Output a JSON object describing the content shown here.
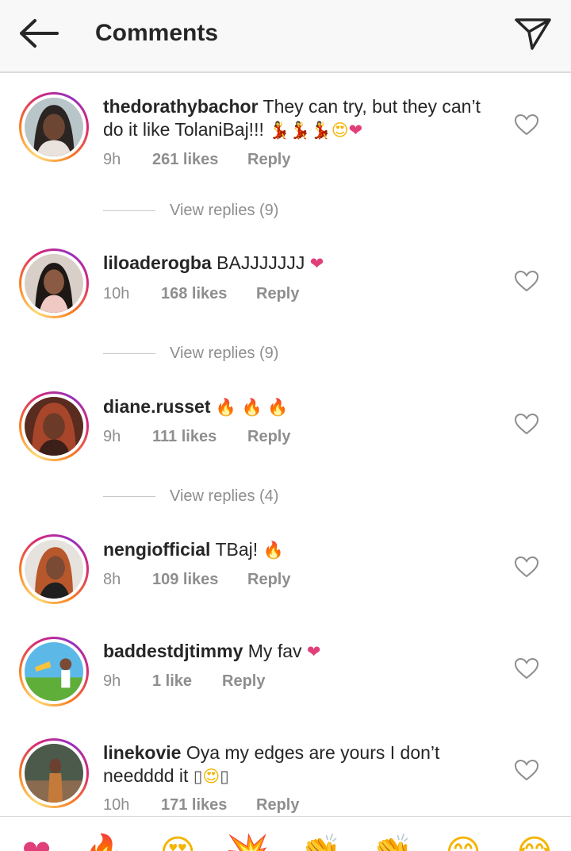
{
  "header": {
    "title": "Comments",
    "back_icon": "arrow-left-icon",
    "send_icon": "paper-plane-icon"
  },
  "comments": [
    {
      "username": "thedorathybachor",
      "text": "They can try, but they can’t do it like TolaniBaj!!!",
      "emojis": [
        "💃",
        "💃",
        "💃",
        "😍",
        "❤"
      ],
      "time": "9h",
      "likes": "261 likes",
      "reply": "Reply",
      "view_replies": "View replies (9)"
    },
    {
      "username": "liloaderogba",
      "text": "BAJJJJJJJ",
      "emojis": [
        "❤"
      ],
      "time": "10h",
      "likes": "168 likes",
      "reply": "Reply",
      "view_replies": "View replies (9)"
    },
    {
      "username": "diane.russet",
      "text": "",
      "emojis": [
        "🔥",
        "🔥",
        "🔥"
      ],
      "time": "9h",
      "likes": "111 likes",
      "reply": "Reply",
      "view_replies": "View replies (4)"
    },
    {
      "username": "nengiofficial",
      "text": "TBaj!",
      "emojis": [
        "🔥"
      ],
      "time": "8h",
      "likes": "109 likes",
      "reply": "Reply"
    },
    {
      "username": "baddestdjtimmy",
      "text": "My fav",
      "emojis": [
        "❤"
      ],
      "time": "9h",
      "likes": "1 like",
      "reply": "Reply"
    },
    {
      "username": "linekovie",
      "text": "Oya my edges are yours I don’t needddd it",
      "emojis": [
        "▯",
        "😍",
        "▯"
      ],
      "time": "10h",
      "likes": "171 likes",
      "reply": "Reply"
    }
  ],
  "emoji_bar": [
    "❤",
    "🔥",
    "😍",
    "💥",
    "👏",
    "👏",
    "😊",
    "😂"
  ],
  "colors": {
    "text": "#262626",
    "secondary": "#8e8e8e",
    "header_bg": "#f8f8f8",
    "heart": "#e0407a"
  }
}
